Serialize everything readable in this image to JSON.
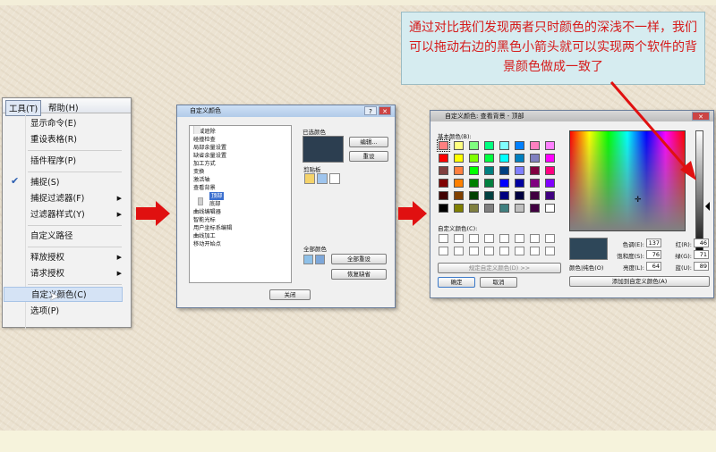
{
  "menu": {
    "tab1": "工具(T)",
    "tab2": "帮助(H)",
    "items": [
      "显示命令(E)",
      "重设表格(R)",
      "插件程序(P)",
      "捕捉(S)",
      "捕捉过滤器(F)",
      "过滤器样式(Y)",
      "自定义路径",
      "释放授权",
      "请求授权",
      "自定义颜色(C)",
      "选项(P)"
    ]
  },
  "dialog1": {
    "title": "自定义颜色",
    "tree": [
      "区域遮除",
      "碰撞检查",
      "局部余量设置",
      "缺省余量设置",
      "加工方式",
      "变换",
      "激活轴",
      "查看背景",
      "顶部",
      "底部",
      "曲线编辑器",
      "智能光标",
      "用户坐标系编辑",
      "曲线加工",
      "移动开始点"
    ],
    "used_colors_label": "已选颜色",
    "edit_btn": "编辑...",
    "reset_btn": "重设",
    "clipboard_label": "剪贴板",
    "all_colors_label": "全部颜色",
    "reset_all_btn": "全部重设",
    "restore_btn": "恢复缺省",
    "close_btn": "关闭"
  },
  "dialog2": {
    "title": "自定义颜色: 查看背景 - 顶部",
    "basic_colors_label": "基本颜色(B):",
    "custom_colors_label": "自定义颜色(C):",
    "define_btn": "规定自定义颜色(D) >>",
    "ok_btn": "确定",
    "cancel_btn": "取消",
    "solid_label": "颜色|纯色(O)",
    "hue_label": "色调(E):",
    "hue": "137",
    "sat_label": "饱和度(S):",
    "sat": "76",
    "lum_label": "亮度(L):",
    "lum": "64",
    "red_label": "红(R):",
    "red": "46",
    "green_label": "绿(G):",
    "green": "71",
    "blue_label": "蓝(U):",
    "blue": "89",
    "add_btn": "添加到自定义颜色(A)",
    "basic_colors": [
      "#ff8080",
      "#ffff80",
      "#80ff80",
      "#00ff80",
      "#80ffff",
      "#0080ff",
      "#ff80c0",
      "#ff80ff",
      "#ff0000",
      "#ffff00",
      "#80ff00",
      "#00ff40",
      "#00ffff",
      "#0080c0",
      "#8080c0",
      "#ff00ff",
      "#804040",
      "#ff8040",
      "#00ff00",
      "#008080",
      "#004080",
      "#8080ff",
      "#800040",
      "#ff0080",
      "#800000",
      "#ff8000",
      "#008000",
      "#008040",
      "#0000ff",
      "#0000a0",
      "#800080",
      "#8000ff",
      "#400000",
      "#804000",
      "#004000",
      "#004040",
      "#000080",
      "#000040",
      "#400040",
      "#400080",
      "#000000",
      "#808000",
      "#808040",
      "#808080",
      "#408080",
      "#c0c0c0",
      "#400040",
      "#ffffff"
    ],
    "selected_color": "#2e4759"
  },
  "callout": {
    "text": "通过对比我们发现两者只时颜色的深浅不一样，我们可以拖动右边的黑色小箭头就可以实现两个软件的背景颜色做成一致了",
    "color": "#d61a1a"
  },
  "accent": "#e01010"
}
